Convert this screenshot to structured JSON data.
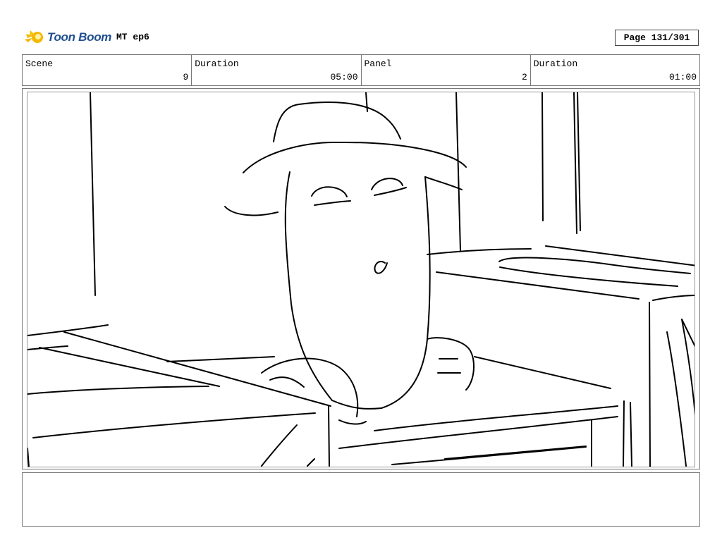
{
  "header": {
    "logo_text": "Toon Boom",
    "project_title": "MT ep6",
    "page_label": "Page 131/301"
  },
  "info": [
    {
      "label": "Scene",
      "value": "9"
    },
    {
      "label": "Duration",
      "value": "05:00"
    },
    {
      "label": "Panel",
      "value": "2"
    },
    {
      "label": "Duration",
      "value": "01:00"
    }
  ],
  "panel": {
    "icon": "sketch-drawing-icon"
  },
  "notes": {
    "text": ""
  },
  "colors": {
    "logo_blue": "#1f4f8f",
    "logo_yellow": "#f5b800",
    "border": "#777777"
  }
}
